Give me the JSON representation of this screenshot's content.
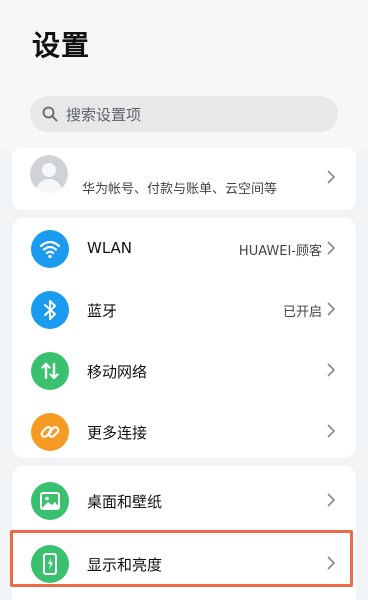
{
  "header": {
    "title": "设置"
  },
  "search": {
    "placeholder": "搜索设置项"
  },
  "account": {
    "subtitle": "华为帐号、付款与账单、云空间等"
  },
  "group1": [
    {
      "label": "WLAN",
      "value": "HUAWEI-顾客",
      "icon": "wifi-icon",
      "color": "#1a9bf0"
    },
    {
      "label": "蓝牙",
      "value": "已开启",
      "icon": "bluetooth-icon",
      "color": "#1a9bf0"
    },
    {
      "label": "移动网络",
      "value": "",
      "icon": "mobile-data-icon",
      "color": "#3ac16f"
    },
    {
      "label": "更多连接",
      "value": "",
      "icon": "link-icon",
      "color": "#f59a23"
    }
  ],
  "group2": [
    {
      "label": "桌面和壁纸",
      "value": "",
      "icon": "image-icon",
      "color": "#3ac16f"
    },
    {
      "label": "显示和亮度",
      "value": "",
      "icon": "display-icon",
      "color": "#3ac16f",
      "highlighted": true
    }
  ],
  "colors": {
    "highlight": "#f06a45",
    "blue": "#1a9bf0",
    "green": "#3ac16f",
    "orange": "#f59a23"
  }
}
